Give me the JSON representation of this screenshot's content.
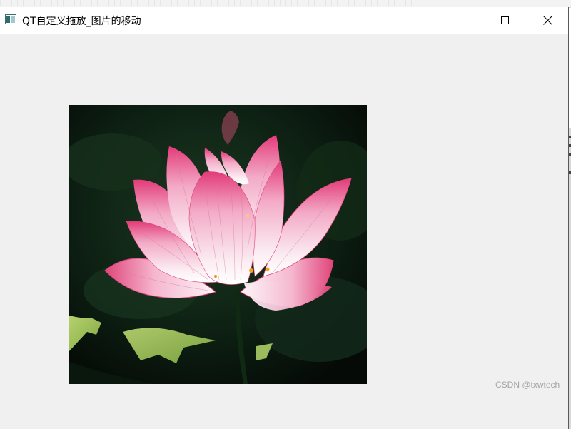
{
  "window": {
    "title": "QT自定义拖放_图片的移动",
    "controls": {
      "minimize": "minimize",
      "maximize": "maximize",
      "close": "close"
    }
  },
  "content": {
    "image_subject": "pink lotus flower on dark green background"
  },
  "watermark": "CSDN @txwtech",
  "colors": {
    "titlebar": "#ffffff",
    "client_background": "#f0f0f0",
    "petal_pink": "#e0457a",
    "background_dark": "#0c1a10"
  }
}
